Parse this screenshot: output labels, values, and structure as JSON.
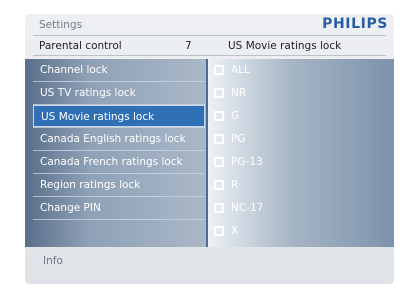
{
  "header": {
    "title": "Settings",
    "brand": "PHILIPS"
  },
  "breadcrumb": {
    "left": "Parental control",
    "count": "7",
    "right": "US Movie ratings lock"
  },
  "menu": {
    "items": [
      {
        "label": "Channel lock"
      },
      {
        "label": "US TV ratings lock"
      },
      {
        "label": "US Movie ratings lock",
        "selected": true
      },
      {
        "label": "Canada English ratings lock"
      },
      {
        "label": "Canada French ratings lock"
      },
      {
        "label": "Region ratings lock"
      },
      {
        "label": "Change PIN"
      },
      {
        "label": ""
      }
    ]
  },
  "options": {
    "items": [
      {
        "label": "ALL",
        "checked": false
      },
      {
        "label": "NR",
        "checked": false
      },
      {
        "label": "G",
        "checked": false
      },
      {
        "label": "PG",
        "checked": false
      },
      {
        "label": "PG-13",
        "checked": false
      },
      {
        "label": "R",
        "checked": false
      },
      {
        "label": "NC-17",
        "checked": false
      },
      {
        "label": "X",
        "checked": false
      }
    ]
  },
  "info": {
    "label": "Info"
  },
  "colors": {
    "accent": "#2f6fb6",
    "brand": "#2a5da8"
  }
}
